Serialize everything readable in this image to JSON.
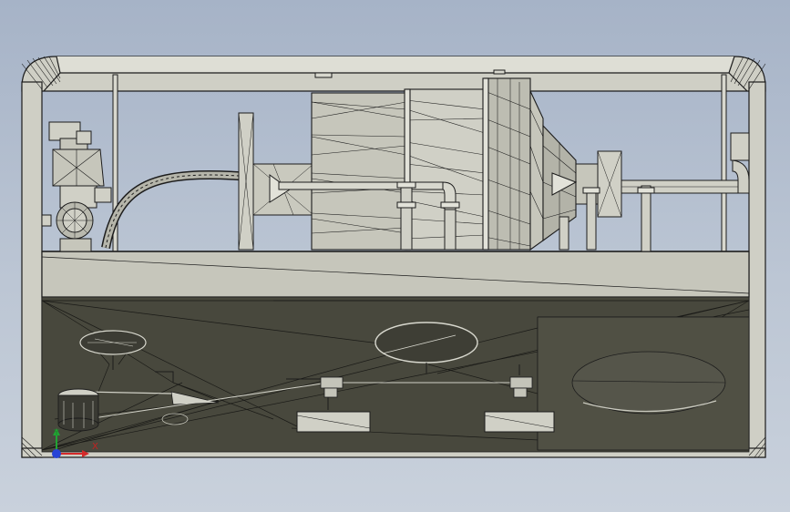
{
  "scene": {
    "colors": {
      "background_top": "#a6b3c7",
      "background_bottom": "#c9d1dc",
      "frame_face": "#cfcfc5",
      "frame_light": "#e4e4dc",
      "deck": "#c6c6bb",
      "lower_cavity": "#48483d",
      "machine_face": "#d0d0c6",
      "machine_mid": "#b9b9ae",
      "edge": "#1c1c1c",
      "axis_x": "#d42a2a",
      "axis_y": "#22a334",
      "axis_z": "#2743d6"
    },
    "icons": [
      "coordinate-triad-icon"
    ]
  },
  "triad": {
    "x_label": "X",
    "y_label": "Y"
  }
}
